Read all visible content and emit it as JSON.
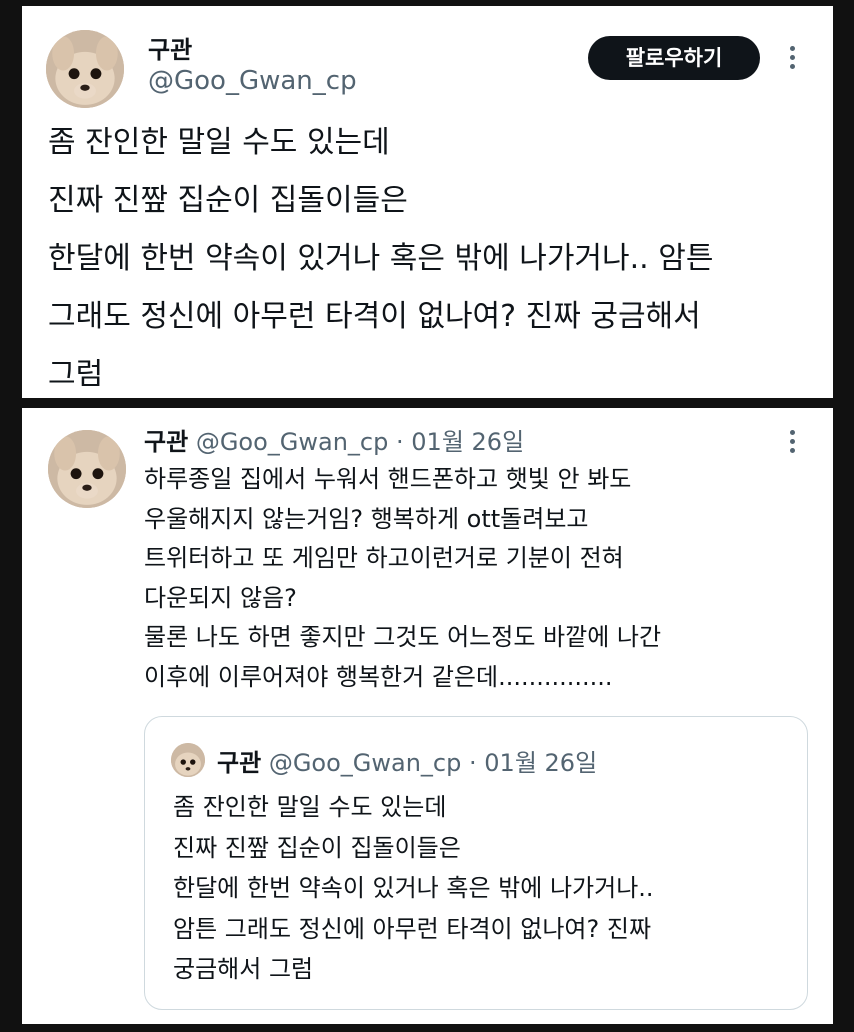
{
  "main_tweet": {
    "name": "구관",
    "handle": "@Goo_Gwan_cp",
    "follow_label": "팔로우하기",
    "lines": [
      "좀 잔인한 말일 수도 있는데",
      "진짜 진짶 집순이 집돌이들은",
      "한달에 한번 약속이 있거나 혹은 밖에 나가거나.. 암튼",
      "그래도 정신에 아무런 타격이 없나여? 진짜 궁금해서",
      "그럼"
    ]
  },
  "reply_tweet": {
    "name": "구관",
    "handle": "@Goo_Gwan_cp",
    "separator": "·",
    "date": "01월 26일",
    "lines": [
      "하루종일 집에서 누워서 핸드폰하고 햇빛 안 봐도",
      "우울해지지 않는거임? 행복하게 ott돌려보고",
      "트위터하고 또 게임만 하고이런거로 기분이 전혀",
      "다운되지 않음?",
      "물론 나도 하면 좋지만 그것도 어느정도 바깥에 나간",
      "이후에 이루어져야 행복한거 같은데..............."
    ],
    "quote": {
      "name": "구관",
      "handle": "@Goo_Gwan_cp",
      "separator": "·",
      "date": "01월 26일",
      "lines": [
        "좀 잔인한 말일 수도 있는데",
        "진짜 진짶 집순이 집돌이들은",
        "한달에 한번 약속이 있거나 혹은 밖에 나가거나..",
        "암튼 그래도 정신에 아무런 타격이 없나여? 진짜",
        "궁금해서 그럼"
      ]
    }
  },
  "icons": [
    "avatar",
    "more-icon"
  ],
  "colors": {
    "background": "#111111",
    "card": "#ffffff",
    "text": "#0f1419",
    "secondary_text": "#536471",
    "follow_button": "#0f1419",
    "border": "#cfd9de"
  }
}
